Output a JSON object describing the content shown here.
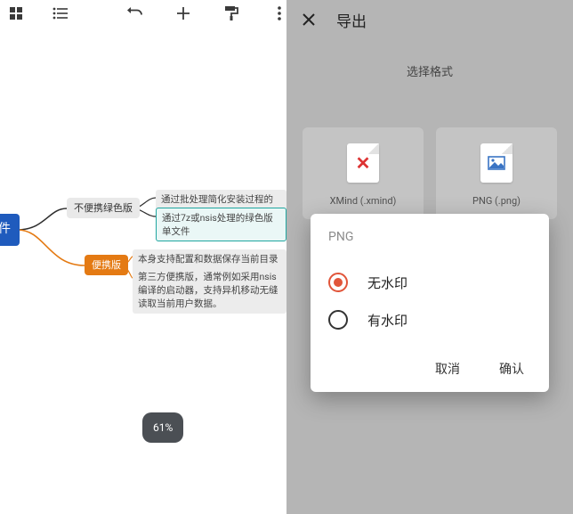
{
  "toolbar": {
    "icons": {
      "grid": "grid-icon",
      "list": "list-icon",
      "undo": "undo-icon",
      "add": "plus-icon",
      "format": "paint-roller-icon",
      "more": "more-vert-icon"
    }
  },
  "mindmap": {
    "root": "色软件",
    "branchA": {
      "label": "不便携绿色版",
      "details": [
        "通过批处理简化安装过程的绿色版",
        "通过7z或nsis处理的绿色版单文件"
      ]
    },
    "branchB": {
      "label": "便携版",
      "details": [
        "本身支持配置和数据保存当前目录的便携版",
        "第三方便携版，通常例如采用nsis编译的启动器，支持异机移动无缝读取当前用户数据。"
      ]
    },
    "edge_colors": {
      "branchA": "#2e2e2e",
      "branchB": "#e47a13"
    }
  },
  "zoom": "61%",
  "export": {
    "title": "导出",
    "subtitle": "选择格式",
    "formats": [
      {
        "label": "XMind (.xmind)",
        "kind": "xmind"
      },
      {
        "label": "PNG (.png)",
        "kind": "png"
      }
    ]
  },
  "dialog": {
    "title": "PNG",
    "options": [
      {
        "label": "无水印",
        "selected": true
      },
      {
        "label": "有水印",
        "selected": false
      }
    ],
    "cancel": "取消",
    "confirm": "确认"
  }
}
